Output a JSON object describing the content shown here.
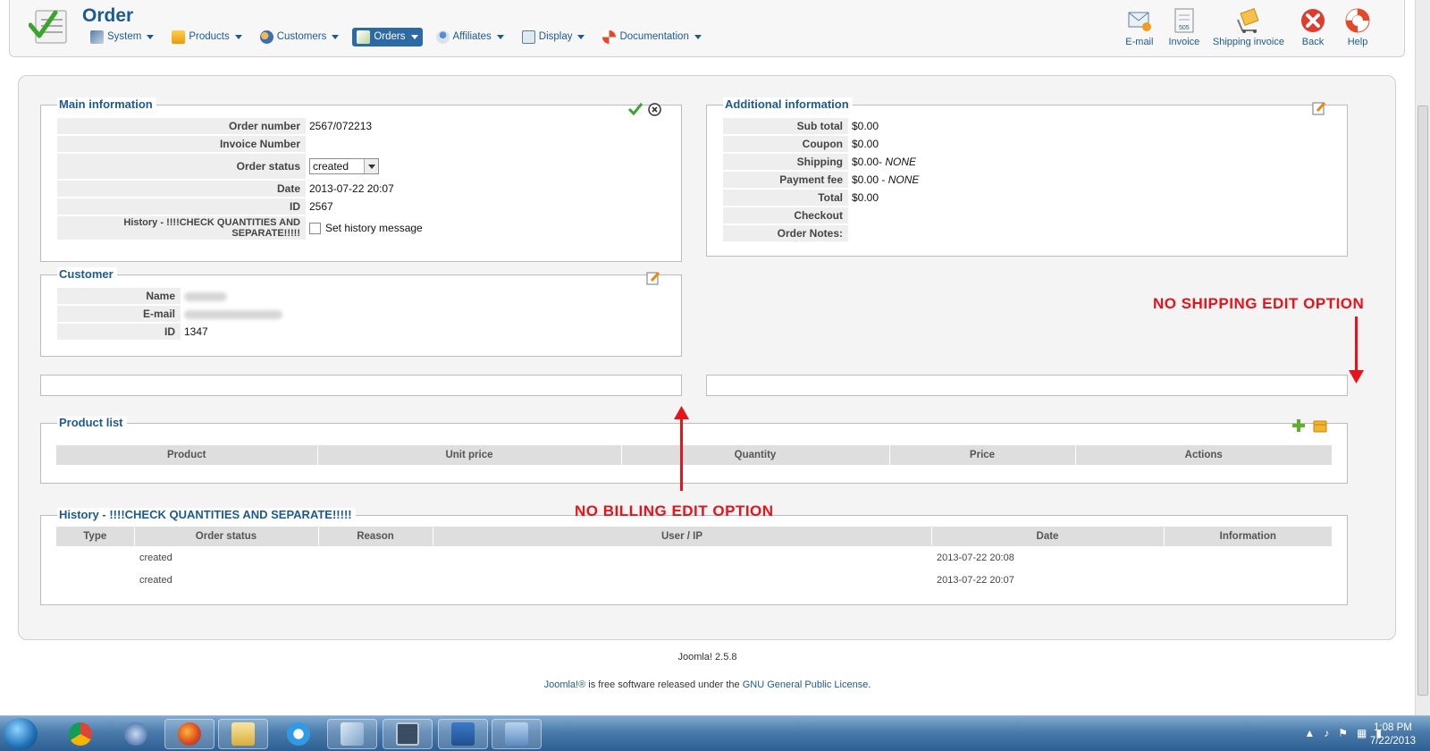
{
  "header": {
    "title": "Order",
    "menu": [
      {
        "label": "System",
        "icon": "tools-icon"
      },
      {
        "label": "Products",
        "icon": "box-icon"
      },
      {
        "label": "Customers",
        "icon": "users-icon"
      },
      {
        "label": "Orders",
        "icon": "orders-icon",
        "active": true
      },
      {
        "label": "Affiliates",
        "icon": "affiliate-icon"
      },
      {
        "label": "Display",
        "icon": "display-icon"
      },
      {
        "label": "Documentation",
        "icon": "lifebuoy-icon"
      }
    ],
    "toolbar": {
      "email": "E-mail",
      "invoice": "Invoice",
      "shipping_invoice": "Shipping invoice",
      "back": "Back",
      "help": "Help",
      "invoice_badge": "505"
    }
  },
  "main_info": {
    "legend": "Main information",
    "order_number_label": "Order number",
    "order_number": "2567/072213",
    "invoice_number_label": "Invoice Number",
    "invoice_number": "",
    "order_status_label": "Order status",
    "order_status": "created",
    "date_label": "Date",
    "date": "2013-07-22 20:07",
    "id_label": "ID",
    "id": "2567",
    "history_label": "History - !!!!CHECK QUANTITIES AND SEPARATE!!!!!",
    "history_checkbox": "Set history message"
  },
  "additional_info": {
    "legend": "Additional information",
    "sub_total_label": "Sub total",
    "sub_total": "$0.00",
    "coupon_label": "Coupon",
    "coupon": "$0.00",
    "shipping_label": "Shipping",
    "shipping": "$0.00-",
    "shipping_method": "NONE",
    "payment_fee_label": "Payment fee",
    "payment_fee": "$0.00 -",
    "payment_method": "NONE",
    "total_label": "Total",
    "total": "$0.00",
    "checkout_label": "Checkout",
    "order_notes_label": "Order Notes:"
  },
  "customer": {
    "legend": "Customer",
    "name_label": "Name",
    "email_label": "E-mail",
    "id_label": "ID",
    "id": "1347"
  },
  "annotations": {
    "shipping": "NO SHIPPING EDIT OPTION",
    "billing": "NO BILLING EDIT OPTION"
  },
  "product_list": {
    "legend": "Product list",
    "columns": [
      "Product",
      "Unit price",
      "Quantity",
      "Price",
      "Actions"
    ]
  },
  "history": {
    "legend": "History - !!!!CHECK QUANTITIES AND SEPARATE!!!!!",
    "columns": [
      "Type",
      "Order status",
      "Reason",
      "User / IP",
      "Date",
      "Information"
    ],
    "rows": [
      {
        "type": "",
        "order_status": "created",
        "reason": "",
        "user_ip": "",
        "date": "2013-07-22 20:08",
        "information": ""
      },
      {
        "type": "",
        "order_status": "created",
        "reason": "",
        "user_ip": "",
        "date": "2013-07-22 20:07",
        "information": ""
      }
    ]
  },
  "footer": {
    "version": "Joomla! 2.5.8",
    "license_link1": "Joomla!®",
    "license_text": " is free software released under the ",
    "license_link2": "GNU General Public License",
    "license_end": "."
  },
  "taskbar": {
    "time": "1:08 PM",
    "date": "7/22/2013"
  },
  "colors": {
    "accent": "#1d5a92",
    "annotation": "#e8121b",
    "active_menu": "#2d6aa5"
  }
}
